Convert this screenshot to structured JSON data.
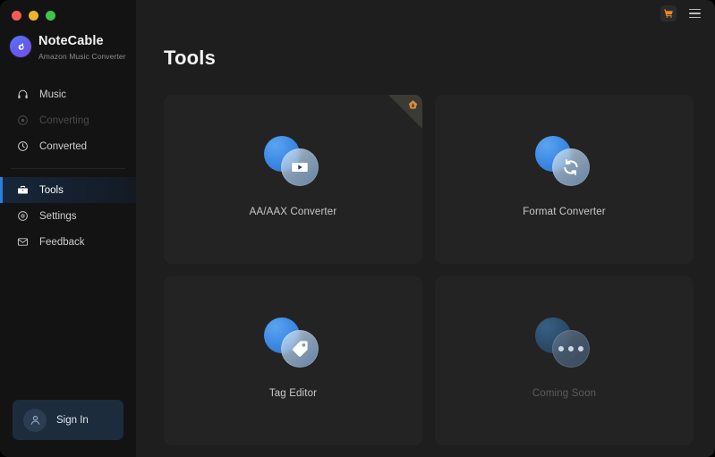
{
  "window": {
    "traffic_lights": [
      {
        "name": "close",
        "color": "#f45b55"
      },
      {
        "name": "minimize",
        "color": "#f0b429"
      },
      {
        "name": "maximize",
        "color": "#3fc44b"
      }
    ]
  },
  "sidebar": {
    "brand": {
      "name": "NoteCable",
      "subtitle": "Amazon Music Converter",
      "logo_icon": "notecable-logo-icon"
    },
    "items": [
      {
        "label": "Music",
        "icon": "headphones-icon",
        "state": "normal"
      },
      {
        "label": "Converting",
        "icon": "converting-circle-icon",
        "state": "disabled"
      },
      {
        "label": "Converted",
        "icon": "clock-icon",
        "state": "normal"
      },
      {
        "label": "Tools",
        "icon": "toolbox-icon",
        "state": "active"
      },
      {
        "label": "Settings",
        "icon": "gear-icon",
        "state": "normal"
      },
      {
        "label": "Feedback",
        "icon": "envelope-icon",
        "state": "normal"
      }
    ],
    "sign_in": {
      "label": "Sign In",
      "avatar_icon": "user-avatar-icon"
    }
  },
  "topbar": {
    "cart_icon": "shopping-cart-icon",
    "menu_icon": "hamburger-menu-icon",
    "accent_color": "#e8892c"
  },
  "main": {
    "title": "Tools",
    "cards": [
      {
        "label": "AA/AAX Converter",
        "icon": "audiobook-play-icon",
        "badge": "audible-badge-icon",
        "has_badge": true,
        "dimmed": false
      },
      {
        "label": "Format Converter",
        "icon": "refresh-sync-icon",
        "has_badge": false,
        "dimmed": false
      },
      {
        "label": "Tag Editor",
        "icon": "price-tag-icon",
        "has_badge": false,
        "dimmed": false
      },
      {
        "label": "Coming Soon",
        "icon": "ellipsis-dots-icon",
        "has_badge": false,
        "dimmed": true
      }
    ]
  },
  "colors": {
    "sidebar_bg": "#131313",
    "main_bg": "#1e1e1e",
    "card_bg": "#232323",
    "active_accent": "#2b7fe0",
    "icon_blue": "#3f8ce6"
  }
}
